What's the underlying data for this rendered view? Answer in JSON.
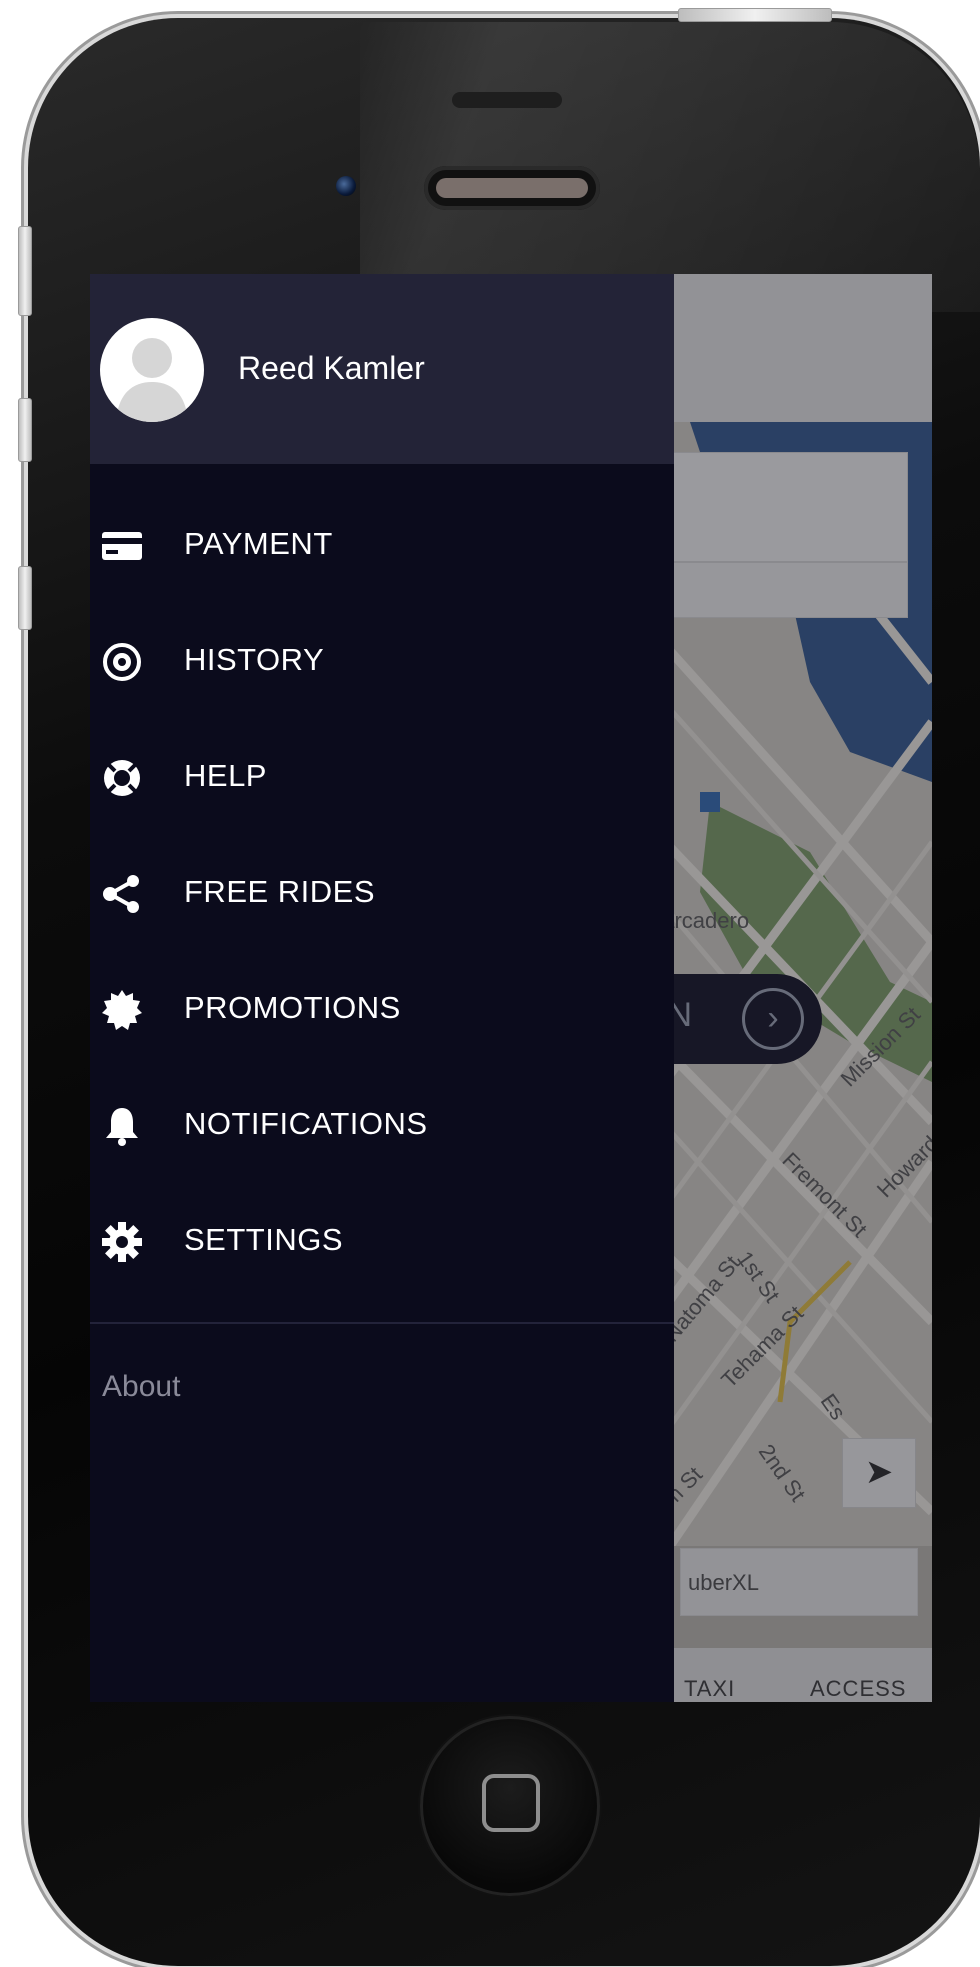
{
  "user": {
    "name": "Reed Kamler"
  },
  "menu": {
    "items": [
      {
        "label": "PAYMENT",
        "icon": "credit-card-icon"
      },
      {
        "label": "HISTORY",
        "icon": "history-icon"
      },
      {
        "label": "HELP",
        "icon": "lifebuoy-icon"
      },
      {
        "label": "FREE RIDES",
        "icon": "share-icon"
      },
      {
        "label": "PROMOTIONS",
        "icon": "badge-icon"
      },
      {
        "label": "NOTIFICATIONS",
        "icon": "bell-icon"
      },
      {
        "label": "SETTINGS",
        "icon": "gear-icon"
      }
    ],
    "about_label": "About"
  },
  "map": {
    "pickup_button_text": "ON",
    "streets": [
      "barcadero",
      "Mission St",
      "Howard",
      "Fremont St",
      "1st St",
      "Natoma St",
      "Tehama St",
      "Es",
      "2nd St",
      "m St"
    ],
    "vehicle_option": "uberXL",
    "bottom_tabs": [
      "TAXI",
      "ACCESS"
    ]
  },
  "colors": {
    "menu_bg": "#0b0b1c",
    "menu_header_bg": "#232337",
    "menu_text": "#ffffff",
    "about_text": "#8a8a99"
  }
}
